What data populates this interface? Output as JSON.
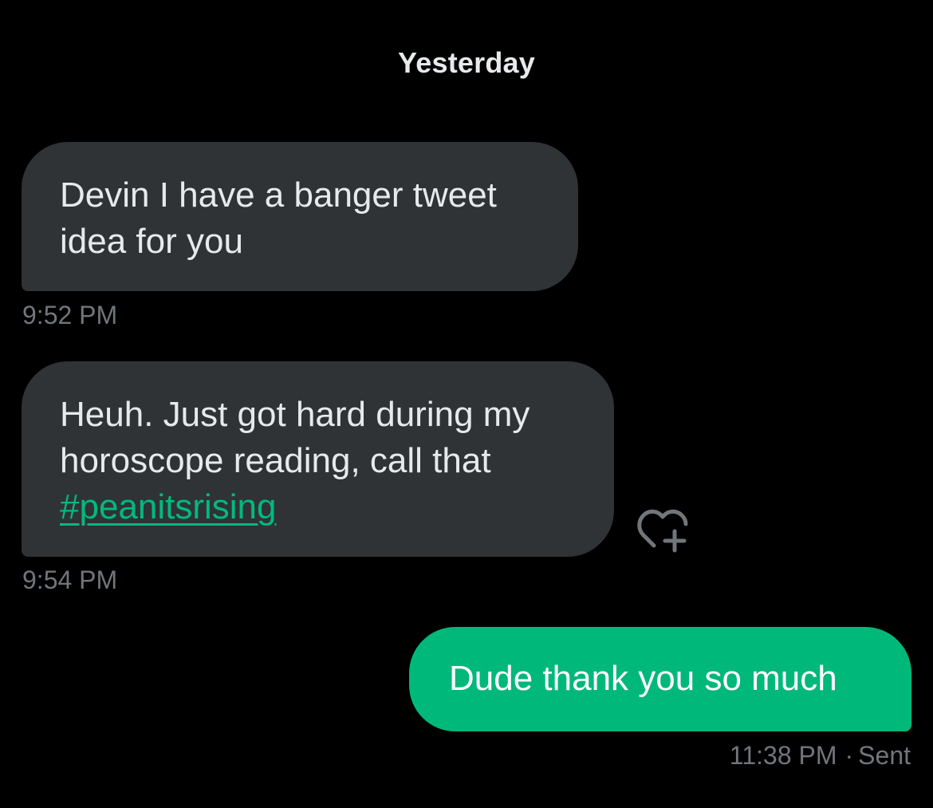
{
  "conversation": {
    "date_divider": "Yesterday",
    "messages": [
      {
        "direction": "received",
        "text": "Devin I have a banger tweet idea for you",
        "time": "9:52 PM"
      },
      {
        "direction": "received",
        "text_before": "Heuh. Just got hard during my horoscope reading, call that ",
        "hashtag": "#peanitsrising",
        "time": "9:54 PM",
        "reaction_icon": "add-reaction-heart-icon"
      },
      {
        "direction": "sent",
        "text": "Dude thank you so much",
        "time": "11:38 PM",
        "separator": "·",
        "status": "Sent"
      }
    ]
  },
  "colors": {
    "background": "#000000",
    "received_bubble": "#2f3336",
    "sent_bubble": "#00b87a",
    "hashtag": "#00ba7c",
    "timestamp": "#71767b",
    "text": "#e7e9ea"
  }
}
